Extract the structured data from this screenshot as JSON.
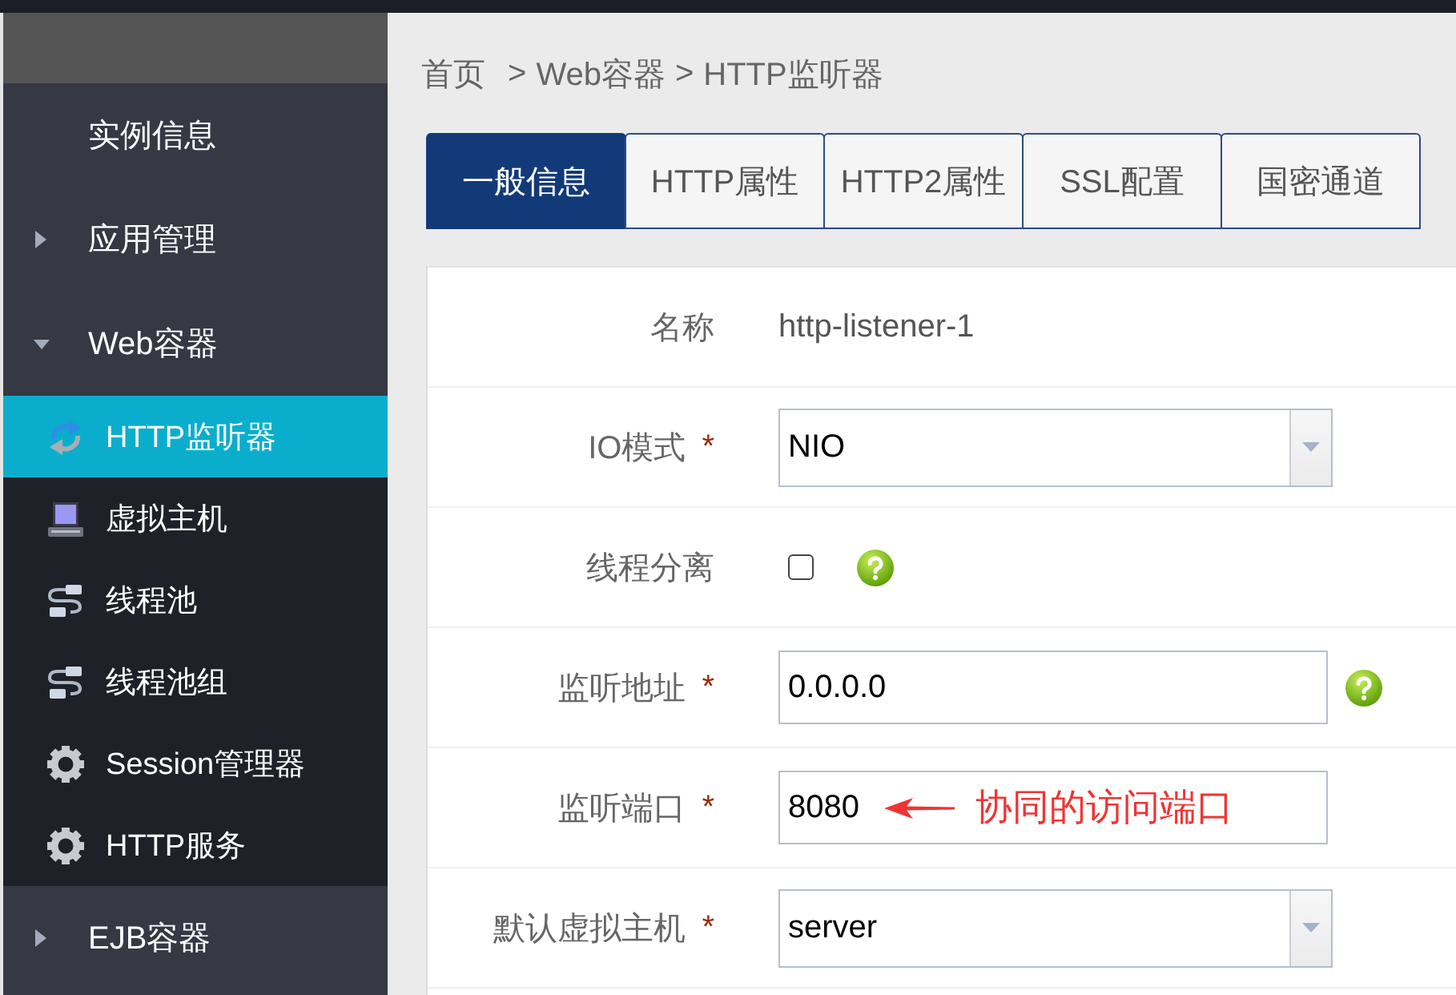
{
  "breadcrumb": [
    {
      "kind": "item",
      "label": "首页"
    },
    {
      "kind": "separator",
      "label": ">"
    },
    {
      "kind": "item",
      "label": "Web容器"
    },
    {
      "kind": "separator",
      "label": ">"
    },
    {
      "kind": "item",
      "label": "HTTP监听器"
    }
  ],
  "sidebar": {
    "items": [
      {
        "kind": "leaf",
        "label": "实例信息",
        "selected": false
      },
      {
        "kind": "group",
        "label": "应用管理",
        "expanded": false,
        "selected": false
      },
      {
        "kind": "group",
        "label": "Web容器",
        "expanded": true,
        "selected": false,
        "children": [
          {
            "kind": "listener",
            "label": "HTTP监听器",
            "selected": true
          },
          {
            "kind": "host",
            "label": "虚拟主机",
            "selected": false
          },
          {
            "kind": "pool",
            "label": "线程池",
            "selected": false
          },
          {
            "kind": "pool",
            "label": "线程池组",
            "selected": false
          },
          {
            "kind": "service",
            "label": "Session管理器",
            "selected": false
          },
          {
            "kind": "service",
            "label": "HTTP服务",
            "selected": false
          }
        ]
      },
      {
        "kind": "group",
        "label": "EJB容器",
        "expanded": false,
        "selected": false
      }
    ]
  },
  "tabs": [
    {
      "label": "一般信息",
      "selected": true
    },
    {
      "label": "HTTP属性",
      "selected": false
    },
    {
      "label": "HTTP2属性",
      "selected": false
    },
    {
      "label": "SSL配置",
      "selected": false
    },
    {
      "label": "国密通道",
      "selected": false
    }
  ],
  "form": {
    "rows": [
      {
        "kind": "text",
        "label": "名称",
        "value": "http-listener-1"
      },
      {
        "kind": "select",
        "label": "IO模式",
        "required_mark": "*",
        "value": "NIO"
      },
      {
        "kind": "checkbox",
        "label": "线程分离",
        "checked": false,
        "help": true
      },
      {
        "kind": "input",
        "label": "监听地址",
        "required_mark": "*",
        "value": "0.0.0.0",
        "help": true
      },
      {
        "kind": "input",
        "label": "监听端口",
        "required_mark": "*",
        "value": "8080",
        "note": "协同的访问端口"
      },
      {
        "kind": "select",
        "label": "默认虚拟主机",
        "required_mark": "*",
        "value": "server"
      }
    ]
  }
}
